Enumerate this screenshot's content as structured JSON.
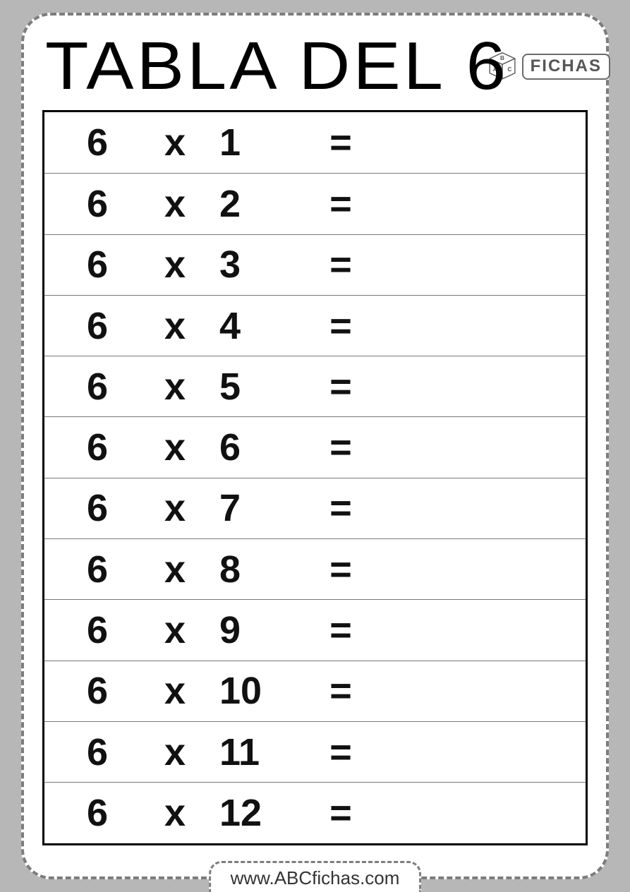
{
  "title": "TABLA DEL 6",
  "logo": {
    "text": "FICHAS",
    "letters": [
      "B",
      "A",
      "C"
    ]
  },
  "footer": "www.ABCfichas.com",
  "symbols": {
    "times": "x",
    "equals": "="
  },
  "rows": [
    {
      "a": "6",
      "b": "1",
      "answer": ""
    },
    {
      "a": "6",
      "b": "2",
      "answer": ""
    },
    {
      "a": "6",
      "b": "3",
      "answer": ""
    },
    {
      "a": "6",
      "b": "4",
      "answer": ""
    },
    {
      "a": "6",
      "b": "5",
      "answer": ""
    },
    {
      "a": "6",
      "b": "6",
      "answer": ""
    },
    {
      "a": "6",
      "b": "7",
      "answer": ""
    },
    {
      "a": "6",
      "b": "8",
      "answer": ""
    },
    {
      "a": "6",
      "b": "9",
      "answer": ""
    },
    {
      "a": "6",
      "b": "10",
      "answer": ""
    },
    {
      "a": "6",
      "b": "11",
      "answer": ""
    },
    {
      "a": "6",
      "b": "12",
      "answer": ""
    }
  ]
}
